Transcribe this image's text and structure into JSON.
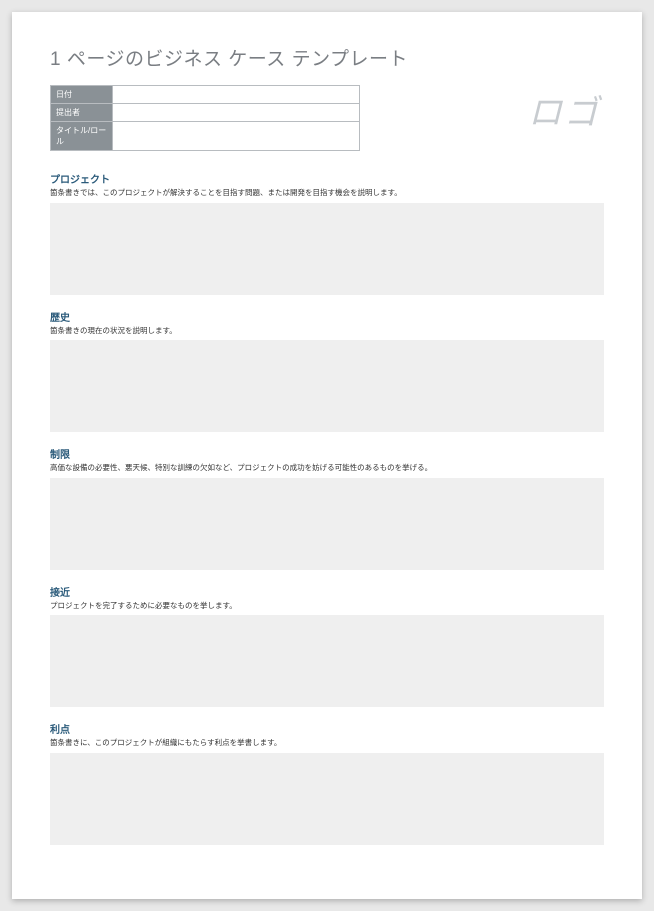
{
  "title": "1 ページのビジネス ケース テンプレート",
  "meta": {
    "rows": [
      {
        "label": "日付",
        "value": ""
      },
      {
        "label": "提出者",
        "value": ""
      },
      {
        "label": "タイトル/ロール",
        "value": ""
      }
    ]
  },
  "logo_text": "ロゴ",
  "sections": [
    {
      "heading": "プロジェクト",
      "desc": "箇条書きでは、このプロジェクトが解決することを目指す問題、または開発を目指す機会を説明します。",
      "content": ""
    },
    {
      "heading": "歴史",
      "desc": "箇条書きの現在の状況を説明します。",
      "content": ""
    },
    {
      "heading": "制限",
      "desc": "高価な設備の必要性、悪天候、特別な訓練の欠如など、プロジェクトの成功を妨げる可能性のあるものを挙げる。",
      "content": ""
    },
    {
      "heading": "接近",
      "desc": "プロジェクトを完了するために必要なものを挙します。",
      "content": ""
    },
    {
      "heading": "利点",
      "desc": "箇条書きに、このプロジェクトが組織にもたらす利点を挙書します。",
      "content": ""
    }
  ]
}
